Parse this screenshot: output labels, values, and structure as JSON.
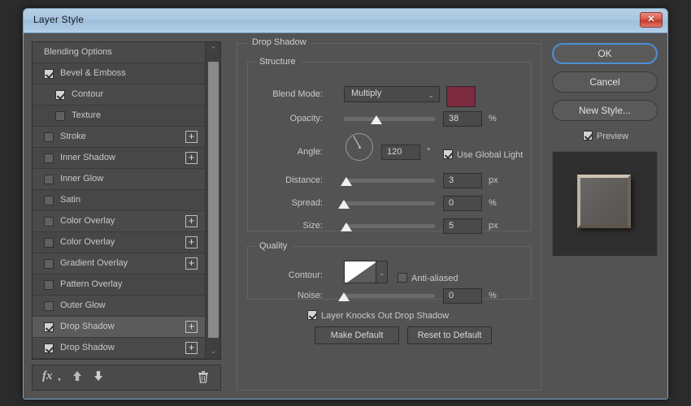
{
  "window": {
    "title": "Layer Style",
    "close_label": "✕"
  },
  "sidebar": {
    "items": [
      {
        "label": "Blending Options",
        "checkbox": null,
        "plus": false,
        "indent": false,
        "selected": false
      },
      {
        "label": "Bevel & Emboss",
        "checkbox": true,
        "plus": false,
        "indent": false,
        "selected": false
      },
      {
        "label": "Contour",
        "checkbox": true,
        "plus": false,
        "indent": true,
        "selected": false
      },
      {
        "label": "Texture",
        "checkbox": false,
        "plus": false,
        "indent": true,
        "selected": false
      },
      {
        "label": "Stroke",
        "checkbox": false,
        "plus": true,
        "indent": false,
        "selected": false
      },
      {
        "label": "Inner Shadow",
        "checkbox": false,
        "plus": true,
        "indent": false,
        "selected": false
      },
      {
        "label": "Inner Glow",
        "checkbox": false,
        "plus": false,
        "indent": false,
        "selected": false
      },
      {
        "label": "Satin",
        "checkbox": false,
        "plus": false,
        "indent": false,
        "selected": false
      },
      {
        "label": "Color Overlay",
        "checkbox": false,
        "plus": true,
        "indent": false,
        "selected": false
      },
      {
        "label": "Color Overlay",
        "checkbox": false,
        "plus": true,
        "indent": false,
        "selected": false
      },
      {
        "label": "Gradient Overlay",
        "checkbox": false,
        "plus": true,
        "indent": false,
        "selected": false
      },
      {
        "label": "Pattern Overlay",
        "checkbox": false,
        "plus": false,
        "indent": false,
        "selected": false
      },
      {
        "label": "Outer Glow",
        "checkbox": false,
        "plus": false,
        "indent": false,
        "selected": false
      },
      {
        "label": "Drop Shadow",
        "checkbox": true,
        "plus": true,
        "indent": false,
        "selected": true
      },
      {
        "label": "Drop Shadow",
        "checkbox": true,
        "plus": true,
        "indent": false,
        "selected": false
      }
    ],
    "toolbar": {
      "fx_label": "fx",
      "fx_caret": "▾",
      "move_up_icon": "move-up",
      "move_down_icon": "move-down",
      "delete_icon": "🗑"
    },
    "scrollbar": {
      "up": "⌃",
      "down": "⌄"
    }
  },
  "effect_panel": {
    "title": "Drop Shadow",
    "structure": {
      "legend": "Structure",
      "blend_mode": {
        "label": "Blend Mode:",
        "value": "Multiply",
        "caret": "⌄"
      },
      "color_swatch": {
        "name": "shadow-color",
        "hex": "#7d2a3e"
      },
      "opacity": {
        "label": "Opacity:",
        "value": "38",
        "unit": "%",
        "knob_pct": 36
      },
      "angle": {
        "label": "Angle:",
        "value": "120",
        "unit": "°",
        "degrees": 120
      },
      "use_global_light": {
        "label": "Use Global Light",
        "checked": true
      },
      "distance": {
        "label": "Distance:",
        "value": "3",
        "unit": "px",
        "knob_pct": 3
      },
      "spread": {
        "label": "Spread:",
        "value": "0",
        "unit": "%",
        "knob_pct": 0
      },
      "size": {
        "label": "Size:",
        "value": "5",
        "unit": "px",
        "knob_pct": 3
      }
    },
    "quality": {
      "legend": "Quality",
      "contour": {
        "label": "Contour:",
        "caret": "⌄"
      },
      "anti_aliased": {
        "label": "Anti-aliased",
        "checked": false
      },
      "noise": {
        "label": "Noise:",
        "value": "0",
        "unit": "%",
        "knob_pct": 0
      }
    },
    "knockout": {
      "label": "Layer Knocks Out Drop Shadow",
      "checked": true
    },
    "make_default_label": "Make Default",
    "reset_default_label": "Reset to Default"
  },
  "actions": {
    "ok_label": "OK",
    "cancel_label": "Cancel",
    "new_style_label": "New Style...",
    "preview": {
      "label": "Preview",
      "checked": true
    }
  }
}
